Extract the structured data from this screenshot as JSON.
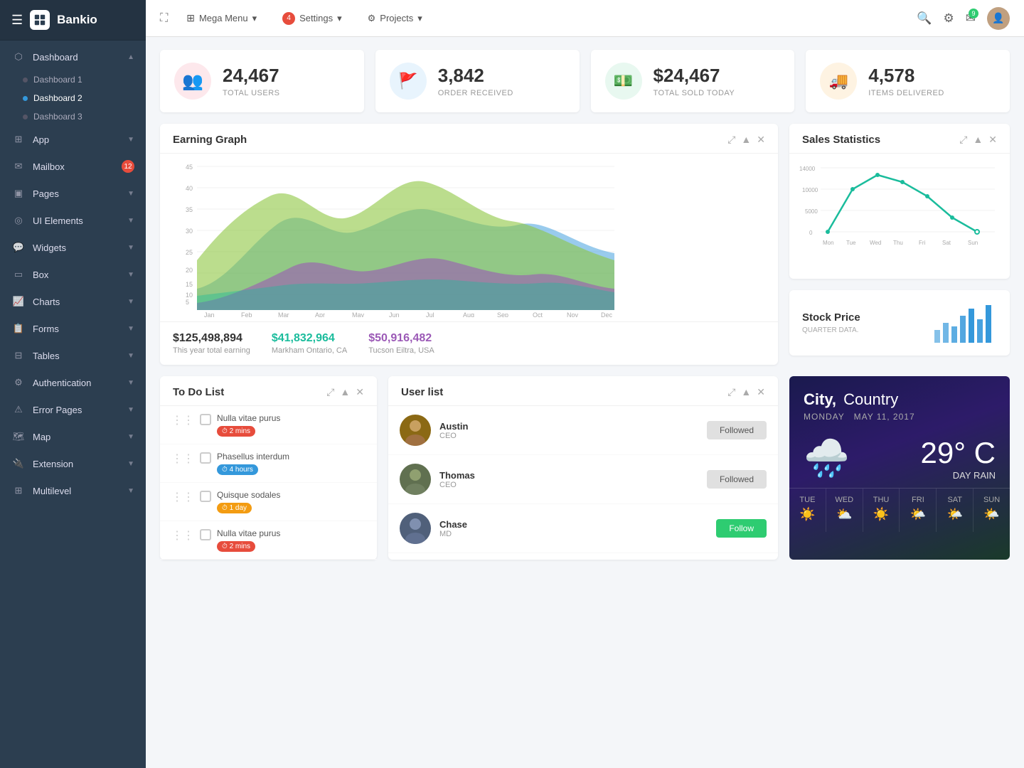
{
  "app": {
    "name": "Bankio",
    "logo_icon": "box-icon"
  },
  "topbar": {
    "expand_icon": "expand-icon",
    "mega_menu_label": "Mega Menu",
    "settings_label": "Settings",
    "settings_badge": "4",
    "projects_label": "Projects",
    "search_icon": "search-icon",
    "gear_icon": "settings-icon",
    "mail_icon": "mail-icon",
    "mail_badge": "9",
    "avatar_icon": "user-avatar"
  },
  "sidebar": {
    "hamburger_icon": "hamburger-icon",
    "items": [
      {
        "id": "dashboard",
        "label": "Dashboard",
        "icon": "dashboard-icon",
        "expanded": true,
        "badge": null
      },
      {
        "id": "dashboard1",
        "label": "Dashboard 1",
        "sub": true,
        "active": false
      },
      {
        "id": "dashboard2",
        "label": "Dashboard 2",
        "sub": true,
        "active": true
      },
      {
        "id": "dashboard3",
        "label": "Dashboard 3",
        "sub": true,
        "active": false
      },
      {
        "id": "app",
        "label": "App",
        "icon": "app-icon",
        "badge": null
      },
      {
        "id": "mailbox",
        "label": "Mailbox",
        "icon": "mail-icon",
        "badge": "12"
      },
      {
        "id": "pages",
        "label": "Pages",
        "icon": "pages-icon"
      },
      {
        "id": "ui-elements",
        "label": "UI Elements",
        "icon": "ui-icon"
      },
      {
        "id": "widgets",
        "label": "Widgets",
        "icon": "widgets-icon"
      },
      {
        "id": "box",
        "label": "Box",
        "icon": "box-icon"
      },
      {
        "id": "charts",
        "label": "Charts",
        "icon": "charts-icon"
      },
      {
        "id": "forms",
        "label": "Forms",
        "icon": "forms-icon"
      },
      {
        "id": "tables",
        "label": "Tables",
        "icon": "tables-icon"
      },
      {
        "id": "authentication",
        "label": "Authentication",
        "icon": "auth-icon"
      },
      {
        "id": "error-pages",
        "label": "Error Pages",
        "icon": "error-icon"
      },
      {
        "id": "map",
        "label": "Map",
        "icon": "map-icon"
      },
      {
        "id": "extension",
        "label": "Extension",
        "icon": "extension-icon"
      },
      {
        "id": "multilevel",
        "label": "Multilevel",
        "icon": "multilevel-icon"
      }
    ]
  },
  "stats": [
    {
      "id": "total-users",
      "value": "24,467",
      "label": "TOTAL USERS",
      "icon": "users-icon",
      "color": "pink",
      "emoji": "👥"
    },
    {
      "id": "order-received",
      "value": "3,842",
      "label": "ORDER RECEIVED",
      "icon": "flag-icon",
      "color": "blue",
      "emoji": "🚩"
    },
    {
      "id": "total-sold",
      "value": "$24,467",
      "label": "TOTAL SOLD TODAY",
      "icon": "dollar-icon",
      "color": "green",
      "emoji": "💵"
    },
    {
      "id": "items-delivered",
      "value": "4,578",
      "label": "ITEMS DELIVERED",
      "icon": "truck-icon",
      "color": "orange",
      "emoji": "🚚"
    }
  ],
  "earning_graph": {
    "title": "Earning Graph",
    "stat1_value": "$125,498,894",
    "stat1_label": "This year total earning",
    "stat2_value": "$41,832,964",
    "stat2_label": "Markham Ontario, CA",
    "stat3_value": "$50,916,482",
    "stat3_label": "Tucson Eiltra, USA",
    "months": [
      "Jan",
      "Feb",
      "Mar",
      "Apr",
      "May",
      "Jun",
      "Jul",
      "Aug",
      "Sep",
      "Oct",
      "Nov",
      "Dec"
    ]
  },
  "sales_statistics": {
    "title": "Sales Statistics",
    "y_labels": [
      "14000",
      "10000",
      "5000",
      "0"
    ],
    "x_labels": [
      "Mon",
      "Tue",
      "Wed",
      "Thu",
      "Fri",
      "Sat",
      "Sun"
    ]
  },
  "stock_price": {
    "title": "Stock Price",
    "subtitle": "QUARTER DATA."
  },
  "todo": {
    "title": "To Do List",
    "items": [
      {
        "id": "todo1",
        "text": "Nulla vitae purus",
        "badge": "⏱ 2 mins",
        "badge_color": "red"
      },
      {
        "id": "todo2",
        "text": "Phasellus interdum",
        "badge": "⏱ 4 hours",
        "badge_color": "blue"
      },
      {
        "id": "todo3",
        "text": "Quisque sodales",
        "badge": "⏱ 1 day",
        "badge_color": "orange"
      },
      {
        "id": "todo4",
        "text": "Nulla vitae purus",
        "badge": "⏱ 2 mins",
        "badge_color": "red"
      }
    ]
  },
  "user_list": {
    "title": "User list",
    "users": [
      {
        "id": "austin",
        "name": "Austin",
        "role": "CEO",
        "status": "Followed",
        "followed": true
      },
      {
        "id": "thomas",
        "name": "Thomas",
        "role": "CEO",
        "status": "Followed",
        "followed": true
      },
      {
        "id": "chase",
        "name": "Chase",
        "role": "MD",
        "status": "Follow",
        "followed": false
      }
    ]
  },
  "weather": {
    "city": "City,",
    "country": "Country",
    "day": "MONDAY",
    "date": "May 11, 2017",
    "temp": "29° C",
    "description": "DAY RAIN",
    "icon": "🌧️",
    "forecast": [
      {
        "day": "TUE",
        "icon": "☀️"
      },
      {
        "day": "WED",
        "icon": "⛅"
      },
      {
        "day": "THU",
        "icon": "☀️"
      },
      {
        "day": "FRI",
        "icon": "🌤️"
      },
      {
        "day": "SAT",
        "icon": "🌤️"
      },
      {
        "day": "SUN",
        "icon": "🌤️"
      }
    ]
  }
}
